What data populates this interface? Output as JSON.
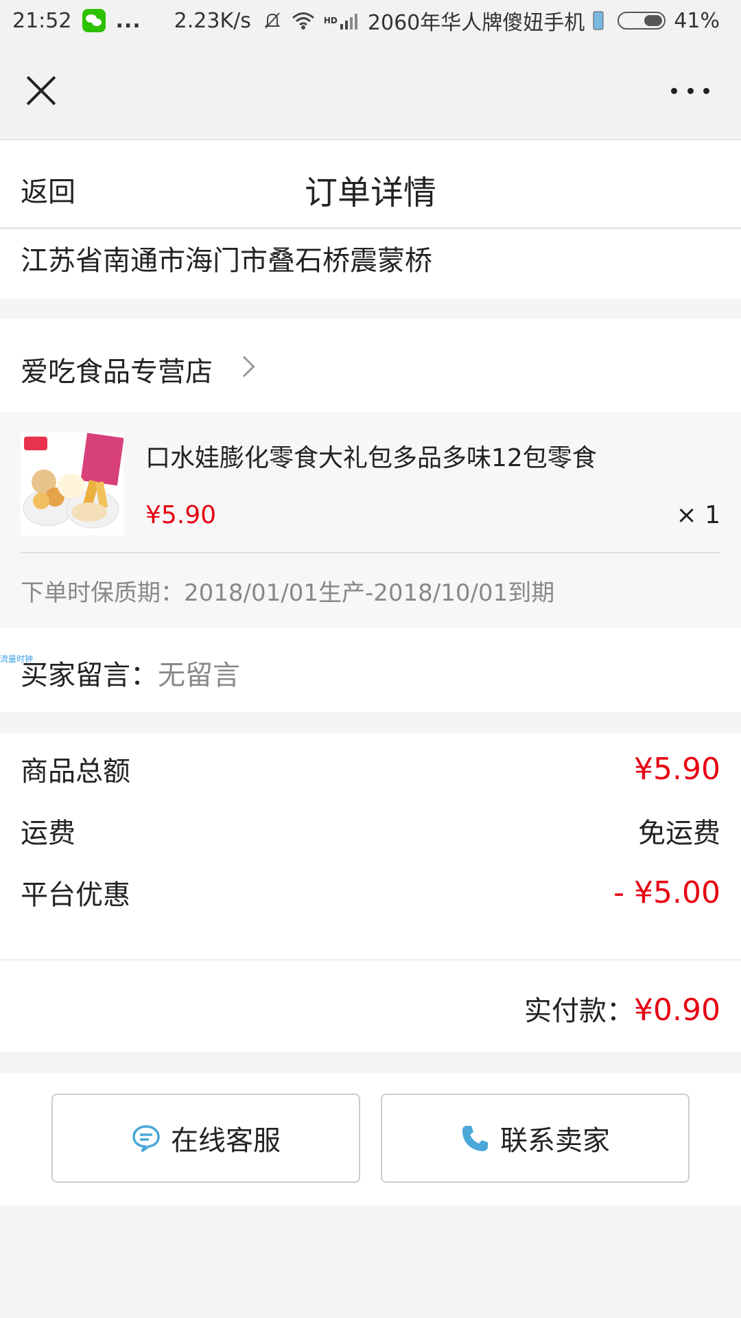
{
  "status_bar": {
    "time": "21:52",
    "dots": "...",
    "speed": "2.23K/s",
    "network_hd": "HD",
    "carrier": "2060年华人牌傻妞手机",
    "battery": "41%"
  },
  "navbar": {
    "close_icon": "close-icon",
    "more_icon": "more-icon"
  },
  "header": {
    "back_label": "返回",
    "title": "订单详情"
  },
  "address": {
    "text": "江苏省南通市海门市叠石桥震蒙桥"
  },
  "store": {
    "name": "爱吃食品专营店"
  },
  "product": {
    "title": "口水娃膨化零食大礼包多品多味12包零食",
    "price": "¥5.90",
    "quantity": "× 1",
    "shelf_life": "下单时保质期：2018/01/01生产-2018/10/01到期"
  },
  "message": {
    "label": "买家留言：",
    "value": "无留言",
    "watermark": "流量时钟"
  },
  "summary": {
    "items": [
      {
        "label": "商品总额",
        "value": "¥5.90"
      },
      {
        "label": "运费",
        "value": "免运费"
      },
      {
        "label": "平台优惠",
        "value": "- ¥5.00"
      }
    ]
  },
  "total": {
    "label": "实付款：",
    "amount": "¥0.90"
  },
  "actions": {
    "customer_service_label": "在线客服",
    "contact_seller_label": "联系卖家"
  },
  "colors": {
    "accent_red": "#e60012",
    "icon_blue": "#4aa8d8"
  }
}
